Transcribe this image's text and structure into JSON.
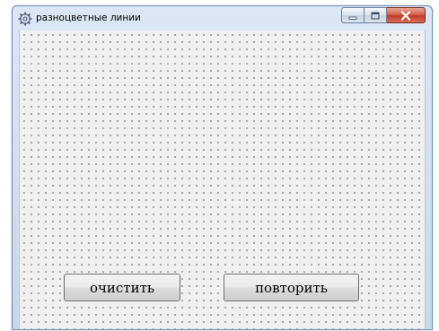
{
  "window": {
    "title": "разноцветные линии",
    "icon": "gear-icon",
    "controls": {
      "minimize_icon": "minimize-icon",
      "maximize_icon": "maximize-icon",
      "close_icon": "close-icon",
      "close_color": "#c1392b"
    }
  },
  "form": {
    "background": "#f0f0f0",
    "grid_dots": true,
    "buttons": {
      "clear_label": "очистить",
      "repeat_label": "повторить"
    }
  }
}
